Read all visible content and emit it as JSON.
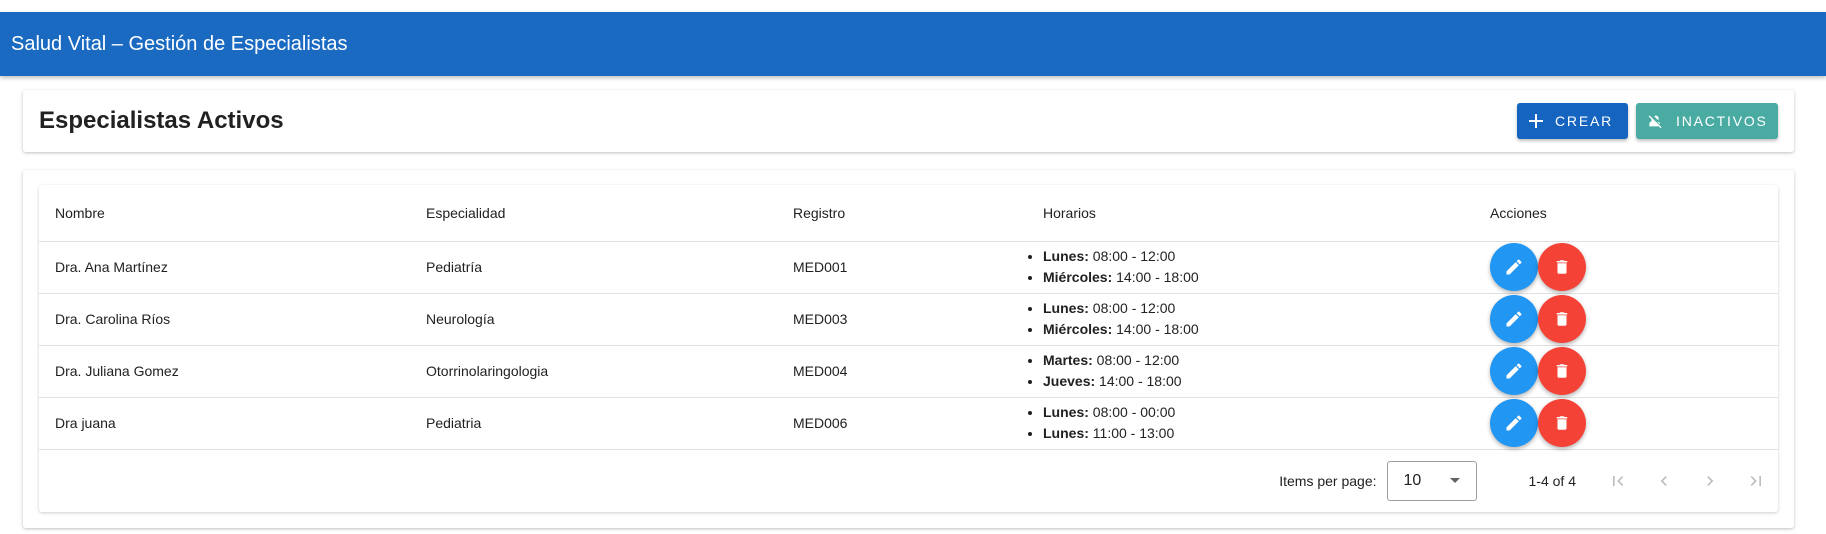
{
  "app": {
    "title": "Salud Vital – Gestión de Especialistas"
  },
  "header": {
    "title": "Especialistas Activos",
    "create_label": "CREAR",
    "inactive_label": "INACTIVOS"
  },
  "table": {
    "columns": [
      "Nombre",
      "Especialidad",
      "Registro",
      "Horarios",
      "Acciones"
    ],
    "rows": [
      {
        "nombre": "Dra. Ana Martínez",
        "especialidad": "Pediatría",
        "registro": "MED001",
        "horarios": [
          {
            "dia": "Lunes:",
            "hora": " 08:00 - 12:00"
          },
          {
            "dia": "Miércoles:",
            "hora": " 14:00 - 18:00"
          }
        ]
      },
      {
        "nombre": "Dra. Carolina Ríos",
        "especialidad": "Neurología",
        "registro": "MED003",
        "horarios": [
          {
            "dia": "Lunes:",
            "hora": " 08:00 - 12:00"
          },
          {
            "dia": "Miércoles:",
            "hora": " 14:00 - 18:00"
          }
        ]
      },
      {
        "nombre": "Dra. Juliana Gomez",
        "especialidad": "Otorrinolaringologia",
        "registro": "MED004",
        "horarios": [
          {
            "dia": "Martes:",
            "hora": " 08:00 - 12:00"
          },
          {
            "dia": "Jueves:",
            "hora": " 14:00 - 18:00"
          }
        ]
      },
      {
        "nombre": "Dra juana",
        "especialidad": "Pediatria",
        "registro": "MED006",
        "horarios": [
          {
            "dia": "Lunes:",
            "hora": " 08:00 - 00:00"
          },
          {
            "dia": "Lunes:",
            "hora": " 11:00 - 13:00"
          }
        ]
      }
    ]
  },
  "paginator": {
    "items_per_page_label": "Items per page:",
    "page_size": "10",
    "range_label": "1-4 of 4"
  },
  "colors": {
    "appbar": "#1a6ac2",
    "create": "#1565c0",
    "inactive": "#4aaba3",
    "edit": "#2196f3",
    "delete": "#f44336"
  },
  "icons": [
    "add-icon",
    "person-off-icon",
    "edit-icon",
    "delete-icon",
    "dropdown-arrow-icon",
    "first-page-icon",
    "previous-page-icon",
    "next-page-icon",
    "last-page-icon"
  ]
}
